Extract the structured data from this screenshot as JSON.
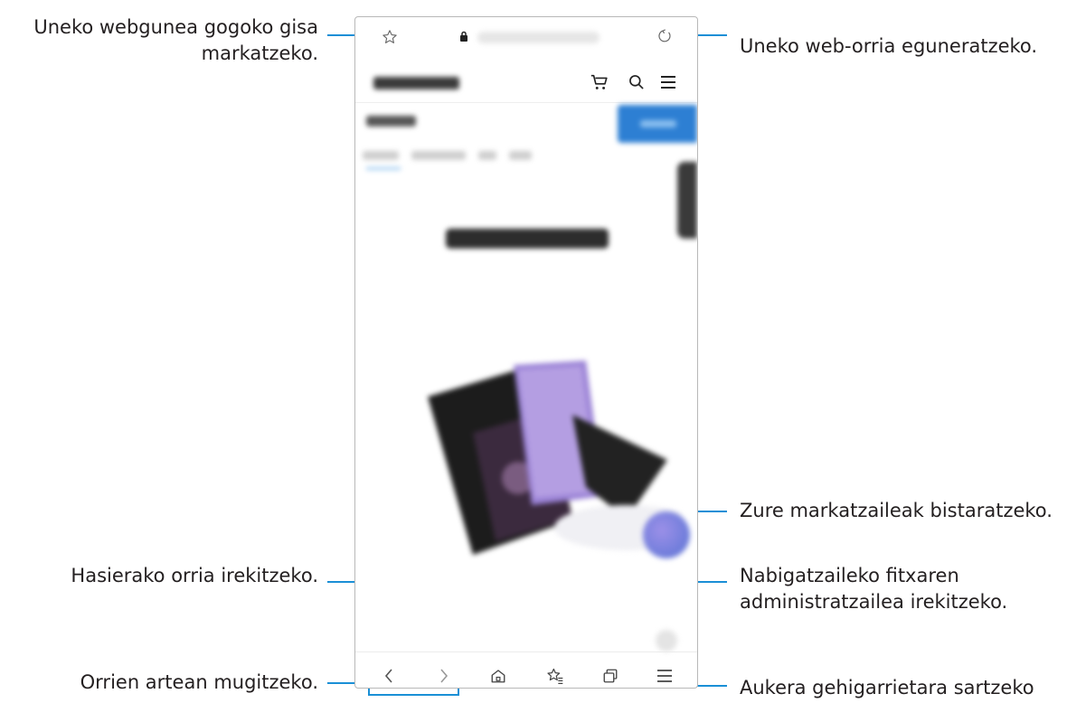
{
  "callouts": {
    "bookmark_current": [
      "Uneko webgunea gogoko gisa",
      "markatzeko."
    ],
    "refresh": "Uneko web-orria eguneratzeko.",
    "view_bookmarks": "Zure markatzaileak bistaratzeko.",
    "home": "Hasierako orria irekitzeko.",
    "tab_manager": [
      "Nabigatzaileko fitxaren",
      "administratzailea irekitzeko."
    ],
    "navigate": "Orrien artean mugitzeko.",
    "more_options": "Aukera gehigarrietara sartzeko"
  },
  "colors": {
    "callout_line": "#1a8fd6",
    "text": "#231f20",
    "frame": "#b8b8b8"
  },
  "icons": {
    "bookmark": "star-icon",
    "lock": "lock-icon",
    "refresh": "refresh-icon",
    "cart": "cart-icon",
    "search": "search-icon",
    "menu": "hamburger-icon",
    "back": "chevron-left-icon",
    "forward": "chevron-right-icon",
    "home": "home-icon",
    "bookmarks": "bookmarks-icon",
    "tabs": "tabs-icon",
    "more": "more-menu-icon"
  }
}
